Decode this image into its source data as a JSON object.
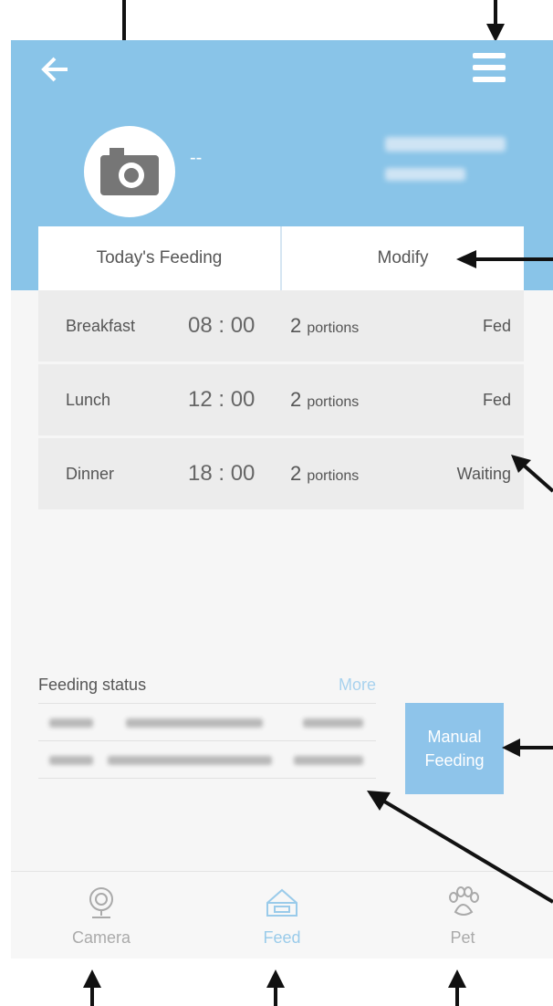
{
  "header": {
    "pet_name": "--"
  },
  "tabs": [
    {
      "label": "Today's Feeding"
    },
    {
      "label": "Modify"
    }
  ],
  "meals": [
    {
      "name": "Breakfast",
      "time": "08 : 00",
      "count": "2",
      "unit": "portions",
      "status": "Fed"
    },
    {
      "name": "Lunch",
      "time": "12 : 00",
      "count": "2",
      "unit": "portions",
      "status": "Fed"
    },
    {
      "name": "Dinner",
      "time": "18 : 00",
      "count": "2",
      "unit": "portions",
      "status": "Waiting"
    }
  ],
  "feeding_status": {
    "title": "Feeding status",
    "more_label": "More"
  },
  "manual_feeding": {
    "line1": "Manual",
    "line2": "Feeding"
  },
  "bottom_nav": [
    {
      "label": "Camera",
      "icon": "camera-icon",
      "active": false
    },
    {
      "label": "Feed",
      "icon": "feed-icon",
      "active": true
    },
    {
      "label": "Pet",
      "icon": "paw-icon",
      "active": false
    }
  ],
  "colors": {
    "header_bg": "#89c4e8",
    "accent": "#8ec4ea",
    "background": "#f6f6f6"
  }
}
